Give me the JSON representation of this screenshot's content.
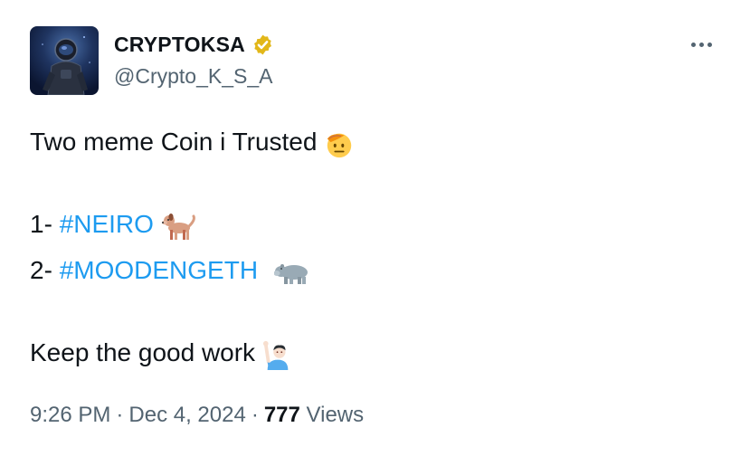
{
  "author": {
    "display_name": "CRYPTOKSA",
    "handle": "@Crypto_K_S_A",
    "verified": true,
    "badge_color": "#e2b719"
  },
  "tweet": {
    "line1": "Two meme Coin i Trusted",
    "line2_prefix": "1- ",
    "line2_hashtag": "#NEIRO",
    "line3_prefix": "2- ",
    "line3_hashtag": "#MOODENGETH",
    "line4": "Keep the good work",
    "emojis": [
      "saluting-face",
      "dog",
      "hippopotamus",
      "man-raising-hand"
    ]
  },
  "meta": {
    "time": "9:26 PM",
    "separator": "·",
    "date": "Dec 4, 2024",
    "views_count": "777",
    "views_label": "Views"
  },
  "colors": {
    "text": "#0f1419",
    "secondary": "#536471",
    "link": "#1d9bf0"
  }
}
